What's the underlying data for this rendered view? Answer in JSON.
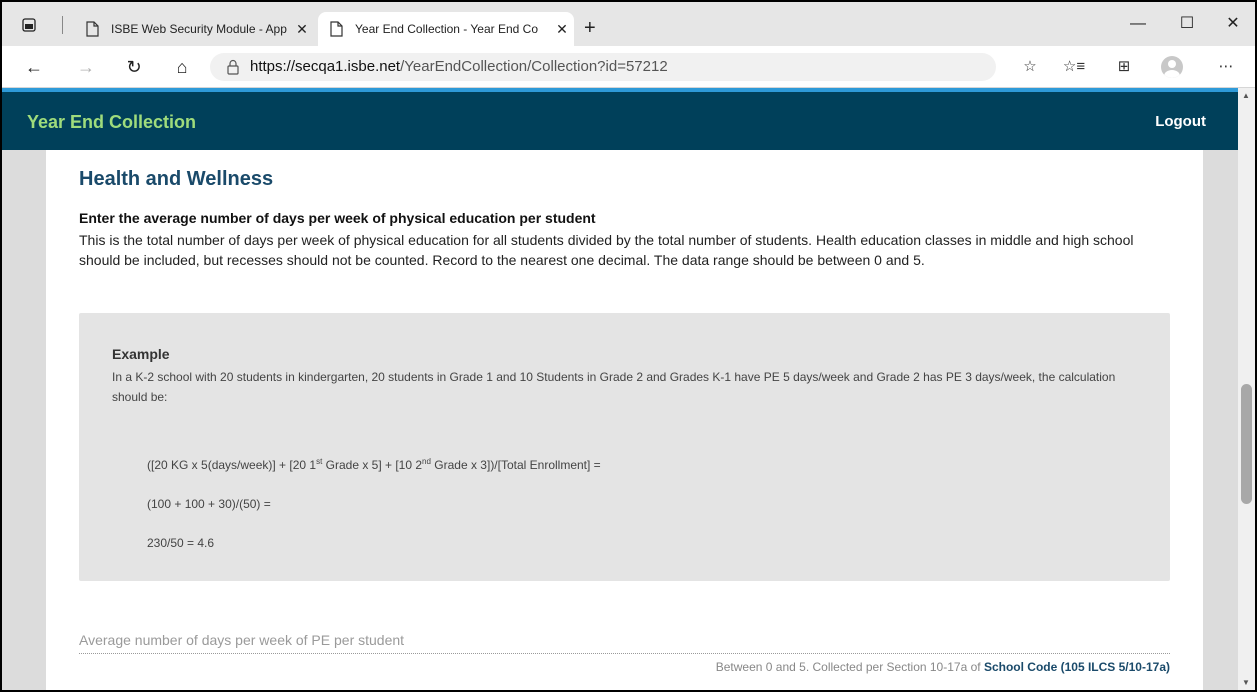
{
  "browser": {
    "tabs": [
      {
        "title": "ISBE Web Security Module - App",
        "active": false
      },
      {
        "title": "Year End Collection - Year End Co",
        "active": true
      }
    ],
    "new_tab": "+",
    "url_host": "https://secqa1.isbe.net",
    "url_path": "/YearEndCollection/Collection?id=57212"
  },
  "app": {
    "title": "Year End Collection",
    "logout": "Logout",
    "header_color": "#00405a",
    "title_color": "#9fdc7c"
  },
  "section": {
    "title": "Health and Wellness",
    "question_title": "Enter the average number of days per week of physical education per student",
    "question_desc": "This is the total number of days per week of physical education for all students divided by the total number of students. Health education classes in middle and high school should be included, but recesses should not be counted. Record to the nearest one decimal. The data range should be between 0 and 5."
  },
  "example": {
    "title": "Example",
    "text": "In a K-2 school with 20 students in kindergarten, 20 students in Grade 1 and 10 Students in Grade 2 and Grades K-1 have PE 5 days/week and Grade 2 has PE 3 days/week, the calculation should be:",
    "line1_a": "([20 KG x 5(days/week)] + [20 1",
    "line1_sup1": "st",
    "line1_b": " Grade x 5] + [10 2",
    "line1_sup2": "nd",
    "line1_c": " Grade x 3])/[Total Enrollment] =",
    "line2": "(100 + 100 + 30)/(50) =",
    "line3": "230/50 = 4.6"
  },
  "field": {
    "label": "Average number of days per week of PE per student",
    "value": "",
    "help_prefix": "Between 0 and 5. Collected per Section 10-17a of ",
    "help_link": "School Code (105 ILCS 5/10-17a)"
  }
}
